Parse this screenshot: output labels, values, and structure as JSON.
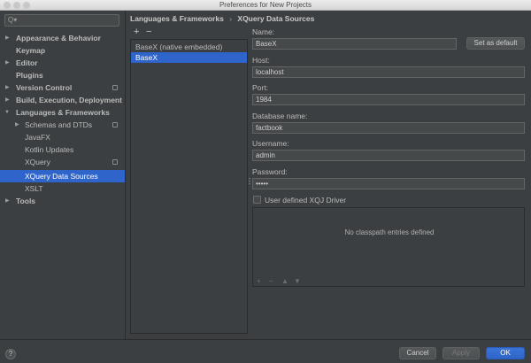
{
  "window": {
    "title": "Preferences for New Projects"
  },
  "search": {
    "placeholder": "Q▾"
  },
  "sidebar": {
    "items": [
      {
        "label": "Appearance & Behavior"
      },
      {
        "label": "Keymap"
      },
      {
        "label": "Editor"
      },
      {
        "label": "Plugins"
      },
      {
        "label": "Version Control"
      },
      {
        "label": "Build, Execution, Deployment"
      },
      {
        "label": "Languages & Frameworks"
      },
      {
        "label": "Schemas and DTDs"
      },
      {
        "label": "JavaFX"
      },
      {
        "label": "Kotlin Updates"
      },
      {
        "label": "XQuery"
      },
      {
        "label": "XQuery Data Sources"
      },
      {
        "label": "XSLT"
      },
      {
        "label": "Tools"
      }
    ]
  },
  "breadcrumb": {
    "parent": "Languages & Frameworks",
    "separator": "›",
    "current": "XQuery Data Sources"
  },
  "list_toolbar": {
    "add": "+",
    "remove": "−"
  },
  "sources": [
    {
      "label": "BaseX (native embedded)"
    },
    {
      "label": "BaseX"
    }
  ],
  "form": {
    "name_label": "Name:",
    "name_value": "BaseX",
    "set_default": "Set as default",
    "host_label": "Host:",
    "host_value": "localhost",
    "port_label": "Port:",
    "port_value": "1984",
    "db_label": "Database name:",
    "db_value": "factbook",
    "user_label": "Username:",
    "user_value": "admin",
    "pass_label": "Password:",
    "pass_value": "•••••",
    "xqj_label": "User defined XQJ Driver"
  },
  "classpath": {
    "empty_text": "No classpath entries defined",
    "add": "+",
    "remove": "−",
    "up": "▲",
    "down": "▼"
  },
  "footer": {
    "help": "?",
    "cancel": "Cancel",
    "apply": "Apply",
    "ok": "OK"
  },
  "colors": {
    "background": "#3c3f41",
    "selection": "#2f65ca",
    "accent_button": "#2f65ca"
  }
}
